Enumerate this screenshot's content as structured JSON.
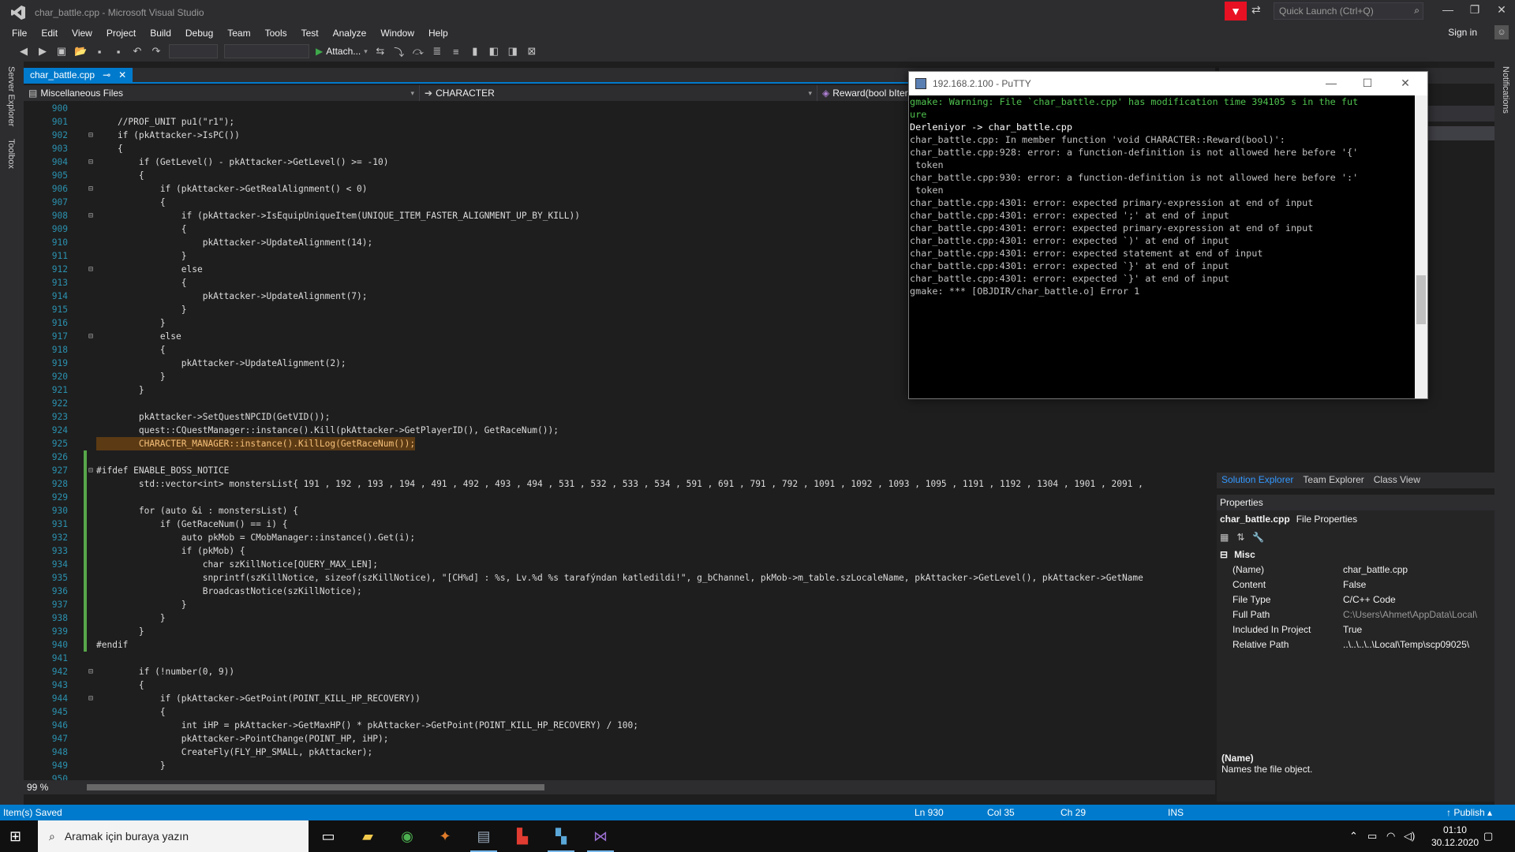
{
  "window": {
    "title": "char_battle.cpp - Microsoft Visual Studio",
    "quick_launch_placeholder": "Quick Launch (Ctrl+Q)",
    "sign_in": "Sign in"
  },
  "menu": [
    "File",
    "Edit",
    "View",
    "Project",
    "Build",
    "Debug",
    "Team",
    "Tools",
    "Test",
    "Analyze",
    "Window",
    "Help"
  ],
  "toolbar": {
    "attach_label": "Attach..."
  },
  "left_rail": [
    "Server Explorer",
    "Toolbox"
  ],
  "right_rail": [
    "Notifications"
  ],
  "tab": {
    "label": "char_battle.cpp"
  },
  "nav": {
    "project": "Miscellaneous Files",
    "scope": "CHARACTER",
    "member": "Reward(bool bIter"
  },
  "code_lines": [
    {
      "n": "900",
      "t": ""
    },
    {
      "n": "901",
      "t": "    //PROF_UNIT pu1(\"r1\");"
    },
    {
      "n": "902",
      "t": "    if (pkAttacker->IsPC())"
    },
    {
      "n": "903",
      "t": "    {"
    },
    {
      "n": "904",
      "t": "        if (GetLevel() - pkAttacker->GetLevel() >= -10)"
    },
    {
      "n": "905",
      "t": "        {"
    },
    {
      "n": "906",
      "t": "            if (pkAttacker->GetRealAlignment() < 0)"
    },
    {
      "n": "907",
      "t": "            {"
    },
    {
      "n": "908",
      "t": "                if (pkAttacker->IsEquipUniqueItem(UNIQUE_ITEM_FASTER_ALIGNMENT_UP_BY_KILL))"
    },
    {
      "n": "909",
      "t": "                {"
    },
    {
      "n": "910",
      "t": "                    pkAttacker->UpdateAlignment(14);"
    },
    {
      "n": "911",
      "t": "                }"
    },
    {
      "n": "912",
      "t": "                else"
    },
    {
      "n": "913",
      "t": "                {"
    },
    {
      "n": "914",
      "t": "                    pkAttacker->UpdateAlignment(7);"
    },
    {
      "n": "915",
      "t": "                }"
    },
    {
      "n": "916",
      "t": "            }"
    },
    {
      "n": "917",
      "t": "            else"
    },
    {
      "n": "918",
      "t": "            {"
    },
    {
      "n": "919",
      "t": "                pkAttacker->UpdateAlignment(2);"
    },
    {
      "n": "920",
      "t": "            }"
    },
    {
      "n": "921",
      "t": "        }"
    },
    {
      "n": "922",
      "t": ""
    },
    {
      "n": "923",
      "t": "        pkAttacker->SetQuestNPCID(GetVID());"
    },
    {
      "n": "924",
      "t": "        quest::CQuestManager::instance().Kill(pkAttacker->GetPlayerID(), GetRaceNum());"
    },
    {
      "n": "925",
      "t": "        CHARACTER_MANAGER::instance().KillLog(GetRaceNum());"
    },
    {
      "n": "926",
      "t": ""
    },
    {
      "n": "927",
      "t": "#ifdef ENABLE_BOSS_NOTICE"
    },
    {
      "n": "928",
      "t": "        std::vector<int> monstersList{ 191 , 192 , 193 , 194 , 491 , 492 , 493 , 494 , 531 , 532 , 533 , 534 , 591 , 691 , 791 , 792 , 1091 , 1092 , 1093 , 1095 , 1191 , 1192 , 1304 , 1901 , 2091 ,"
    },
    {
      "n": "929",
      "t": ""
    },
    {
      "n": "930",
      "t": "        for (auto &i : monstersList) {"
    },
    {
      "n": "931",
      "t": "            if (GetRaceNum() == i) {"
    },
    {
      "n": "932",
      "t": "                auto pkMob = CMobManager::instance().Get(i);"
    },
    {
      "n": "933",
      "t": "                if (pkMob) {"
    },
    {
      "n": "934",
      "t": "                    char szKillNotice[QUERY_MAX_LEN];"
    },
    {
      "n": "935",
      "t": "                    snprintf(szKillNotice, sizeof(szKillNotice), \"[CH%d] : %s, Lv.%d %s tarafýndan katledildi!\", g_bChannel, pkMob->m_table.szLocaleName, pkAttacker->GetLevel(), pkAttacker->GetName"
    },
    {
      "n": "936",
      "t": "                    BroadcastNotice(szKillNotice);"
    },
    {
      "n": "937",
      "t": "                }"
    },
    {
      "n": "938",
      "t": "            }"
    },
    {
      "n": "939",
      "t": "        }"
    },
    {
      "n": "940",
      "t": "#endif"
    },
    {
      "n": "941",
      "t": ""
    },
    {
      "n": "942",
      "t": "        if (!number(0, 9))"
    },
    {
      "n": "943",
      "t": "        {"
    },
    {
      "n": "944",
      "t": "            if (pkAttacker->GetPoint(POINT_KILL_HP_RECOVERY))"
    },
    {
      "n": "945",
      "t": "            {"
    },
    {
      "n": "946",
      "t": "                int iHP = pkAttacker->GetMaxHP() * pkAttacker->GetPoint(POINT_KILL_HP_RECOVERY) / 100;"
    },
    {
      "n": "947",
      "t": "                pkAttacker->PointChange(POINT_HP, iHP);"
    },
    {
      "n": "948",
      "t": "                CreateFly(FLY_HP_SMALL, pkAttacker);"
    },
    {
      "n": "949",
      "t": "            }"
    },
    {
      "n": "950",
      "t": ""
    }
  ],
  "zoom": "99 %",
  "putty": {
    "title": "192.168.2.100 - PuTTY",
    "lines": [
      {
        "t": "gmake: Warning: File `char_battle.cpp' has modification time 394105 s in the fut",
        "c": "green"
      },
      {
        "t": "ure",
        "c": "green"
      },
      {
        "t": "Derleniyor -> char_battle.cpp",
        "c": "mixed"
      },
      {
        "t": "char_battle.cpp: In member function 'void CHARACTER::Reward(bool)':",
        "c": "grey"
      },
      {
        "t": "char_battle.cpp:928: error: a function-definition is not allowed here before '{'",
        "c": "grey"
      },
      {
        "t": " token",
        "c": "grey"
      },
      {
        "t": "char_battle.cpp:930: error: a function-definition is not allowed here before ':'",
        "c": "grey"
      },
      {
        "t": " token",
        "c": "grey"
      },
      {
        "t": "char_battle.cpp:4301: error: expected primary-expression at end of input",
        "c": "grey"
      },
      {
        "t": "char_battle.cpp:4301: error: expected ';' at end of input",
        "c": "grey"
      },
      {
        "t": "char_battle.cpp:4301: error: expected primary-expression at end of input",
        "c": "grey"
      },
      {
        "t": "char_battle.cpp:4301: error: expected `)' at end of input",
        "c": "grey"
      },
      {
        "t": "char_battle.cpp:4301: error: expected statement at end of input",
        "c": "grey"
      },
      {
        "t": "char_battle.cpp:4301: error: expected `}' at end of input",
        "c": "grey"
      },
      {
        "t": "char_battle.cpp:4301: error: expected `}' at end of input",
        "c": "grey"
      },
      {
        "t": "gmake: *** [OBJDIR/char_battle.o] Error 1",
        "c": "grey"
      }
    ]
  },
  "panel_tabs": [
    "Solution Explorer",
    "Team Explorer",
    "Class View"
  ],
  "properties": {
    "header": "Properties",
    "object_name": "char_battle.cpp",
    "object_type": "File Properties",
    "category": "Misc",
    "rows": [
      {
        "name": "(Name)",
        "value": "char_battle.cpp"
      },
      {
        "name": "Content",
        "value": "False"
      },
      {
        "name": "File Type",
        "value": "C/C++ Code"
      },
      {
        "name": "Full Path",
        "value": "C:\\Users\\Ahmet\\AppData\\Local\\"
      },
      {
        "name": "Included In Project",
        "value": "True"
      },
      {
        "name": "Relative Path",
        "value": "..\\..\\..\\..\\Local\\Temp\\scp09025\\"
      }
    ],
    "desc_title": "(Name)",
    "desc_text": "Names the file object."
  },
  "status": {
    "message": "Item(s) Saved",
    "ln": "Ln 930",
    "col": "Col 35",
    "ch": "Ch 29",
    "ins": "INS",
    "publish": "Publish"
  },
  "taskbar": {
    "search_placeholder": "Aramak için buraya yazın",
    "time": "01:10",
    "date": "30.12.2020"
  }
}
